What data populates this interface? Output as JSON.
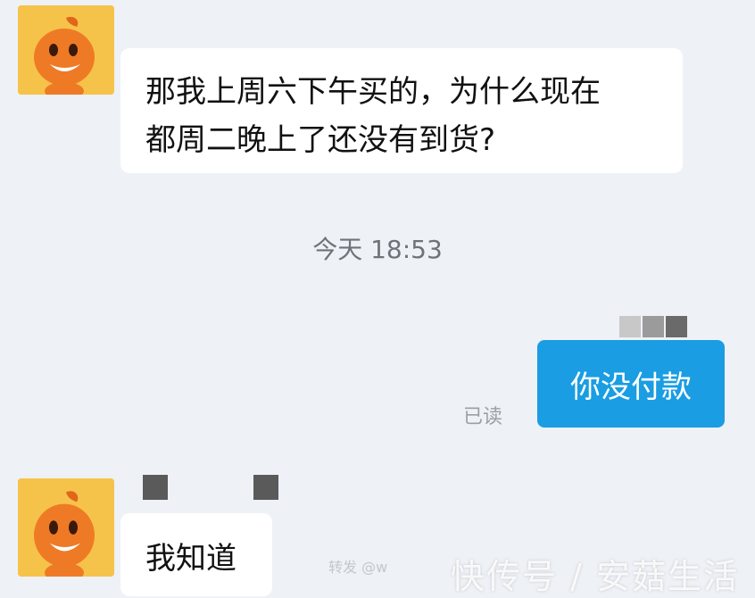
{
  "messages": [
    {
      "line1": "那我上周六下午买的，为什么现在",
      "line2": "都周二晚上了还没有到货?"
    },
    {
      "text": "你没付款",
      "status": "已读"
    },
    {
      "text": "我知道"
    }
  ],
  "timestamp": "今天 18:53",
  "footer_faint": "转发 @w",
  "watermark": "快传号 / 安菇生活",
  "colors": {
    "background": "#eef1f6",
    "outgoing_bubble": "#1a9de2",
    "incoming_bubble": "#ffffff",
    "avatar_bg": "#f6c34a"
  },
  "icons": {
    "avatar": "orange-mascot-icon"
  }
}
